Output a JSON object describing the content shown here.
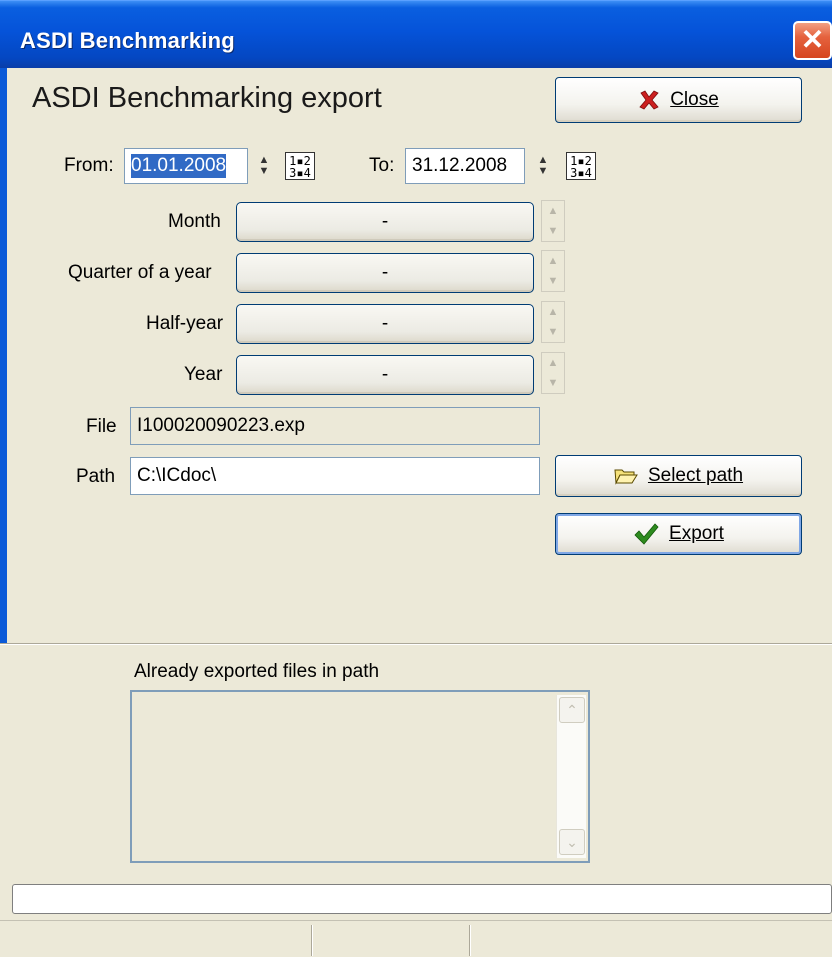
{
  "window": {
    "title": "ASDI Benchmarking",
    "close_glyph": "✕"
  },
  "heading": "ASDI Benchmarking export",
  "buttons": {
    "close": {
      "label": "Close",
      "icon": "red-x-icon"
    },
    "select_path": {
      "label": "Select path",
      "icon": "folder-icon"
    },
    "export": {
      "label": "Export",
      "icon": "checkmark-icon"
    }
  },
  "dates": {
    "from_label": "From:",
    "from_value": "01.01.2008",
    "to_label": "To:",
    "to_value": "31.12.2008"
  },
  "periods": [
    {
      "label": "Month",
      "value": "-"
    },
    {
      "label": "Quarter of a year",
      "value": "-"
    },
    {
      "label": "Half-year",
      "value": "-"
    },
    {
      "label": "Year",
      "value": "-"
    }
  ],
  "file": {
    "label": "File",
    "value": "I100020090223.exp"
  },
  "path": {
    "label": "Path",
    "value": "C:\\ICdoc\\"
  },
  "exported": {
    "label": "Already exported files in path",
    "items": []
  },
  "colors": {
    "titlebar": "#0553d9",
    "background": "#ece9d8",
    "close_red": "#cc1f1f",
    "check_green": "#2e8b1e"
  }
}
